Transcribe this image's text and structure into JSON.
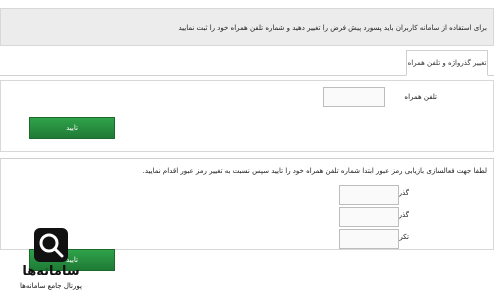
{
  "notice": {
    "text": "برای استفاده از سامانه کاربران باید پسورد پیش فرض را تغییر دهید و شماره تلفن همراه خود را ثبت نمایید"
  },
  "tabs": [
    {
      "label": "تغییر گذرواژه و تلفن همراه"
    }
  ],
  "phone_section": {
    "label": "تلفن همراه",
    "value": "",
    "submit_label": "تایید"
  },
  "password_section": {
    "instruction": "لطفا جهت فعالسازی بازیابی رمز عبور ابتدا شماره تلفن همراه خود را تایید سپس نسبت به تغییر رمز عبور اقدام نمایید.",
    "fields": [
      {
        "label": "گذرواژه قبلی",
        "value": ""
      },
      {
        "label": "گذرواژه جدید",
        "value": ""
      },
      {
        "label": "تکرار گذرواژه جدید",
        "value": ""
      }
    ],
    "submit_label": "تایید"
  },
  "watermark": {
    "brand": "سامانه‌ها",
    "tagline": "پورتال جامع سامانه‌ها",
    "icon": "magnifier-icon"
  }
}
